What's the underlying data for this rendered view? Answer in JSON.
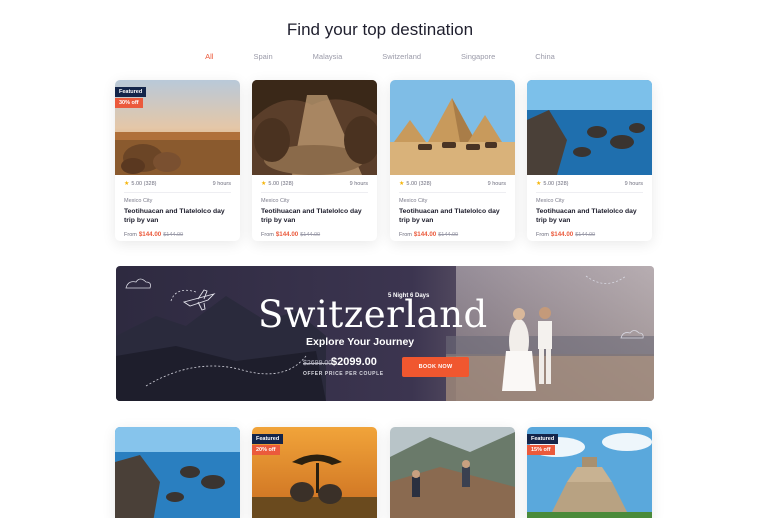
{
  "heading": "Find your top destination",
  "tabs": [
    "All",
    "Spain",
    "Malaysia",
    "Switzerland",
    "Singapore",
    "China"
  ],
  "active_tab": "All",
  "cards": [
    {
      "featured": "Featured",
      "discount": "30% off",
      "rating": "5.00 (328)",
      "duration": "9 hours",
      "location": "Mexico City",
      "name_line1": "Teotihuacan and Tlatelolco day",
      "name_line2": "trip by van",
      "from": "From",
      "price": "$144.00",
      "old_price": "$144.00"
    },
    {
      "rating": "5.00 (328)",
      "duration": "9 hours",
      "location": "Mexico City",
      "name_line1": "Teotihuacan and Tlatelolco day",
      "name_line2": "trip by van",
      "from": "From",
      "price": "$144.00",
      "old_price": "$144.00"
    },
    {
      "rating": "5.00 (328)",
      "duration": "9 hours",
      "location": "Mexico City",
      "name_line1": "Teotihuacan and Tlatelolco day",
      "name_line2": "trip by van",
      "from": "From",
      "price": "$144.00",
      "old_price": "$144.00"
    },
    {
      "rating": "5.00 (328)",
      "duration": "9 hours",
      "location": "Mexico City",
      "name_line1": "Teotihuacan and Tlatelolco day",
      "name_line2": "trip by van",
      "from": "From",
      "price": "$144.00",
      "old_price": "$144.00"
    }
  ],
  "banner": {
    "nights": "5 Night 6 Days",
    "title": "Switzerland",
    "subtitle": "Explore Your Journey",
    "old_price": "$2699.00",
    "price": "$2099.00",
    "offer": "OFFER PRICE PER COUPLE",
    "cta": "BOOK NOW"
  },
  "bottom_cards": [
    {},
    {
      "featured": "Featured",
      "discount": "20% off"
    },
    {},
    {
      "featured": "Featured",
      "discount": "15% off"
    }
  ],
  "colors": {
    "accent": "#eb5a3c",
    "navy": "#14254a",
    "star": "#f5b50a"
  }
}
